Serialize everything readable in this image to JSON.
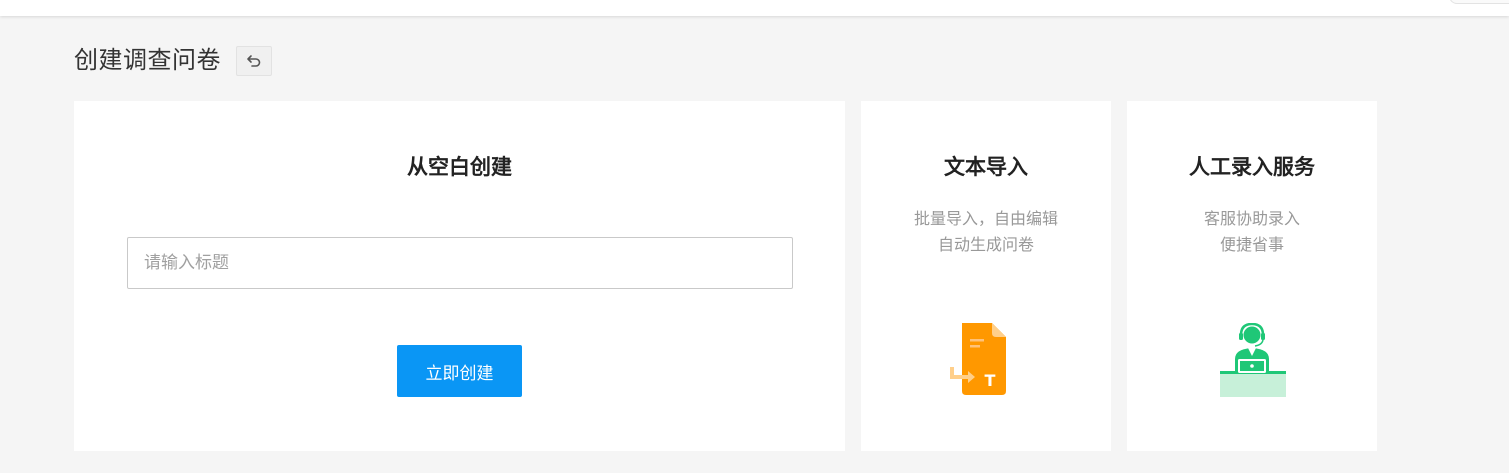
{
  "page": {
    "title": "创建调查问卷",
    "back_icon": "undo-icon"
  },
  "blank_card": {
    "title": "从空白创建",
    "input_placeholder": "请输入标题",
    "input_value": "",
    "create_button": "立即创建"
  },
  "text_import_card": {
    "title": "文本导入",
    "desc_line1": "批量导入，自由编辑",
    "desc_line2": "自动生成问卷",
    "icon": "document-import-icon"
  },
  "manual_card": {
    "title": "人工录入服务",
    "desc_line1": "客服协助录入",
    "desc_line2": "便捷省事",
    "icon": "customer-service-icon"
  },
  "colors": {
    "primary": "#0a96f5",
    "orange": "#ff9800",
    "green": "#1fc777",
    "background": "#f5f5f5"
  }
}
